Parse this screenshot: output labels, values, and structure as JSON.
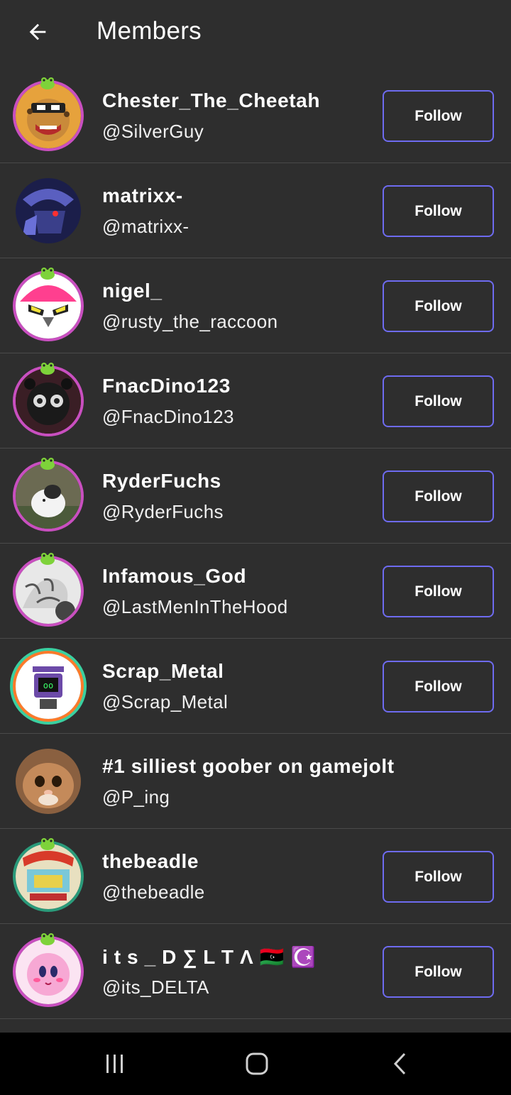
{
  "header": {
    "title": "Members",
    "back_icon": "arrow-left-icon"
  },
  "members": [
    {
      "name": "Chester_The_Cheetah",
      "handle": "@SilverGuy",
      "follow_label": "Follow",
      "avatar_color": "#b7482b"
    },
    {
      "name": "matrixx-",
      "handle": "@matrixx-",
      "follow_label": "Follow",
      "avatar_color": "#2a2f6b"
    },
    {
      "name": "nigel_",
      "handle": "@rusty_the_raccoon",
      "follow_label": "Follow",
      "avatar_color": "#ff4fa0"
    },
    {
      "name": "FnacDino123",
      "handle": "@FnacDino123",
      "follow_label": "Follow",
      "avatar_color": "#3a2e38"
    },
    {
      "name": "RyderFuchs",
      "handle": "@RyderFuchs",
      "follow_label": "Follow",
      "avatar_color": "#5f6a4a"
    },
    {
      "name": "Infamous_God",
      "handle": "@LastMenInTheHood",
      "follow_label": "Follow",
      "avatar_color": "#d8d8d8"
    },
    {
      "name": "Scrap_Metal",
      "handle": "@Scrap_Metal",
      "follow_label": "Follow",
      "avatar_color": "#6c4aa8"
    },
    {
      "name": "#1 silliest goober on gamejolt",
      "handle": "@P_ing",
      "follow_label": "",
      "avatar_color": "#b07a4a"
    },
    {
      "name": "thebeadle",
      "handle": "@thebeadle",
      "follow_label": "Follow",
      "avatar_color": "#3a9a8a"
    },
    {
      "name": " i t s _ D ∑ L T Λ 🇱🇾 ☪️",
      "handle": "@its_DELTA",
      "follow_label": "Follow",
      "avatar_color": "#f5a5d8"
    }
  ],
  "navbar": {
    "recent_icon": "recent-apps-icon",
    "home_icon": "home-icon",
    "back_icon": "back-icon"
  }
}
